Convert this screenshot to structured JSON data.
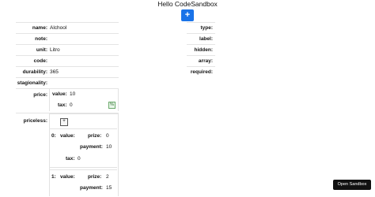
{
  "header": {
    "title": "Hello CodeSandbox",
    "add_label": "+"
  },
  "form": {
    "name": {
      "label": "name:",
      "value": "Alchool"
    },
    "note": {
      "label": "note:",
      "value": ""
    },
    "unit": {
      "label": "unit:",
      "value": "Litro"
    },
    "code": {
      "label": "code:",
      "value": ""
    },
    "durability": {
      "label": "durability:",
      "value": "365"
    },
    "stagionality": {
      "label": "stagionality:",
      "value": ""
    },
    "price": {
      "label": "price:",
      "value_label": "value:",
      "value": "10",
      "tax_label": "tax:",
      "tax": "0",
      "percent_label": "%"
    },
    "priceless": {
      "label": "priceless:",
      "add_label": "+",
      "items": [
        {
          "index": "0:",
          "value_label": "value:",
          "prize_label": "prize:",
          "prize": "0",
          "payment_label": "payment:",
          "payment": "10",
          "tax_label": "tax:",
          "tax": "0"
        },
        {
          "index": "1:",
          "value_label": "value:",
          "prize_label": "prize:",
          "prize": "2",
          "payment_label": "payment:",
          "payment": "15"
        }
      ]
    }
  },
  "meta": {
    "type": "type:",
    "label": "label:",
    "hidden": "hidden:",
    "array": "array:",
    "required": "required:"
  },
  "footer": {
    "open_sandbox": "Open Sandbox"
  }
}
